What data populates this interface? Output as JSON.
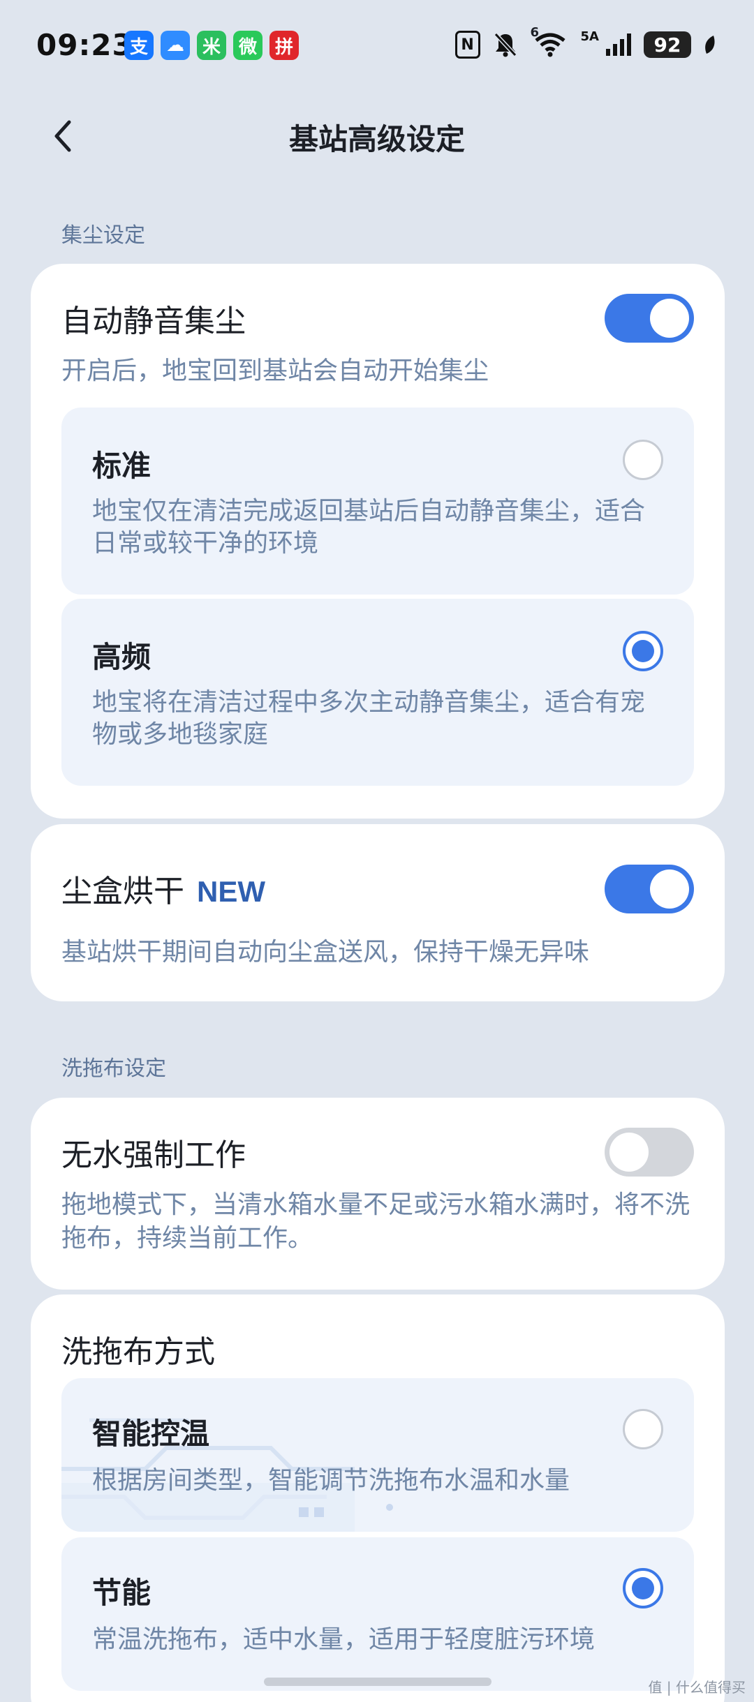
{
  "status_bar": {
    "time": "09:23",
    "apps": [
      "支",
      "☁",
      "米",
      "微",
      "拼"
    ],
    "signal_label": "5A",
    "wifi_label": "6",
    "battery": "92"
  },
  "header": {
    "title": "基站高级设定"
  },
  "dust_section": {
    "label": "集尘设定",
    "auto_quiet": {
      "title": "自动静音集尘",
      "desc": "开启后，地宝回到基站会自动开始集尘",
      "enabled": true,
      "options": [
        {
          "title": "标准",
          "desc": "地宝仅在清洁完成返回基站后自动静音集尘，适合日常或较干净的环境",
          "selected": false
        },
        {
          "title": "高频",
          "desc": "地宝将在清洁过程中多次主动静音集尘，适合有宠物或多地毯家庭",
          "selected": true
        }
      ]
    },
    "dust_dry": {
      "title": "尘盒烘干",
      "badge": "NEW",
      "desc": "基站烘干期间自动向尘盒送风，保持干燥无异味",
      "enabled": true
    }
  },
  "mop_section": {
    "label": "洗拖布设定",
    "no_water": {
      "title": "无水强制工作",
      "desc": "拖地模式下，当清水箱水量不足或污水箱水满时，将不洗拖布，持续当前工作。",
      "enabled": false
    },
    "wash_method": {
      "title": "洗拖布方式",
      "options": [
        {
          "title": "智能控温",
          "desc": "根据房间类型，智能调节洗拖布水温和水量",
          "selected": false
        },
        {
          "title": "节能",
          "desc": "常温洗拖布，适中水量，适用于轻度脏污环境",
          "selected": true
        }
      ]
    }
  },
  "watermark": "值 | 什么值得买",
  "colors": {
    "accent": "#3b78e7",
    "background": "#dfe5ee",
    "card": "#ffffff",
    "option_bg": "#eef3fb",
    "muted_text": "#6f86a6"
  }
}
